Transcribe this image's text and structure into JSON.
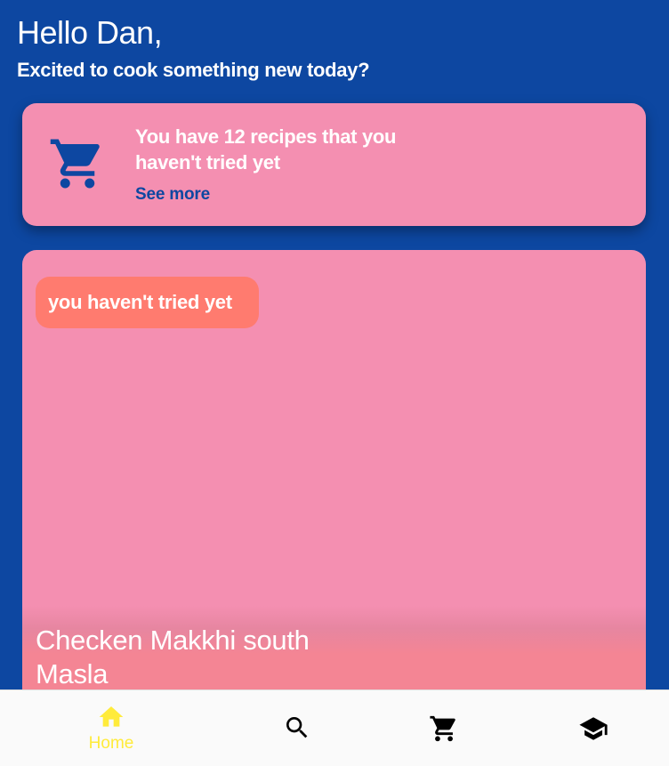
{
  "header": {
    "greeting": "Hello Dan,",
    "subtitle": "Excited to cook something new today?"
  },
  "info_card": {
    "icon": "shopping-cart-icon",
    "text": "You have 12 recipes that you haven't tried yet",
    "link_label": "See more"
  },
  "recipe_card": {
    "tag": "you haven't tried yet",
    "title": "Checken Makkhi south Masla"
  },
  "bottom_nav": {
    "items": [
      {
        "icon": "home-icon",
        "label": "Home",
        "active": true
      },
      {
        "icon": "search-icon",
        "label": "",
        "active": false
      },
      {
        "icon": "shopping-cart-icon",
        "label": "",
        "active": false
      },
      {
        "icon": "school-icon",
        "label": "",
        "active": false
      }
    ]
  },
  "colors": {
    "background": "#0d47a1",
    "card": "#f48fb1",
    "tag": "#ff7b6f",
    "active_nav": "#ffeb3b",
    "nav_bar": "#fafafa"
  }
}
